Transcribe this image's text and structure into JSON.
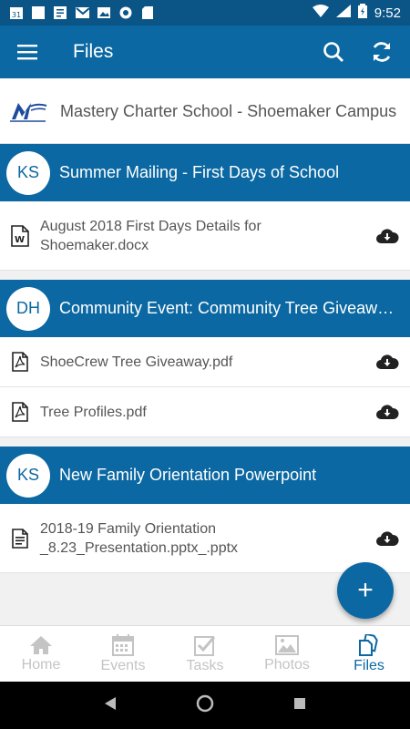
{
  "status_bar": {
    "time": "9:52",
    "calendar_day": "31"
  },
  "app_bar": {
    "title": "Files"
  },
  "school": {
    "name": "Mastery Charter School - Shoemaker Campus"
  },
  "groups": [
    {
      "initials": "KS",
      "title": "Summer Mailing - First Days of School",
      "files": [
        {
          "name": "August 2018 First Days Details for Shoemaker.docx",
          "type": "word"
        }
      ]
    },
    {
      "initials": "DH",
      "title": "Community Event: Community Tree Giveaw…",
      "files": [
        {
          "name": "ShoeCrew Tree Giveaway.pdf",
          "type": "pdf"
        },
        {
          "name": "Tree Profiles.pdf",
          "type": "pdf"
        }
      ]
    },
    {
      "initials": "KS",
      "title": "New Family Orientation Powerpoint",
      "files": [
        {
          "name": "2018-19 Family Orientation _8.23_Presentation.pptx_.pptx",
          "type": "doc"
        }
      ]
    }
  ],
  "fab": {
    "label": "+"
  },
  "bottom_nav": {
    "items": [
      {
        "label": "Home",
        "icon": "home-icon"
      },
      {
        "label": "Events",
        "icon": "calendar-icon"
      },
      {
        "label": "Tasks",
        "icon": "checkbox-icon"
      },
      {
        "label": "Photos",
        "icon": "image-icon"
      },
      {
        "label": "Files",
        "icon": "files-icon"
      }
    ],
    "active": "Files"
  },
  "colors": {
    "primary": "#0b68a2",
    "status_bar": "#0a5586",
    "inactive": "#c4c4c4"
  }
}
